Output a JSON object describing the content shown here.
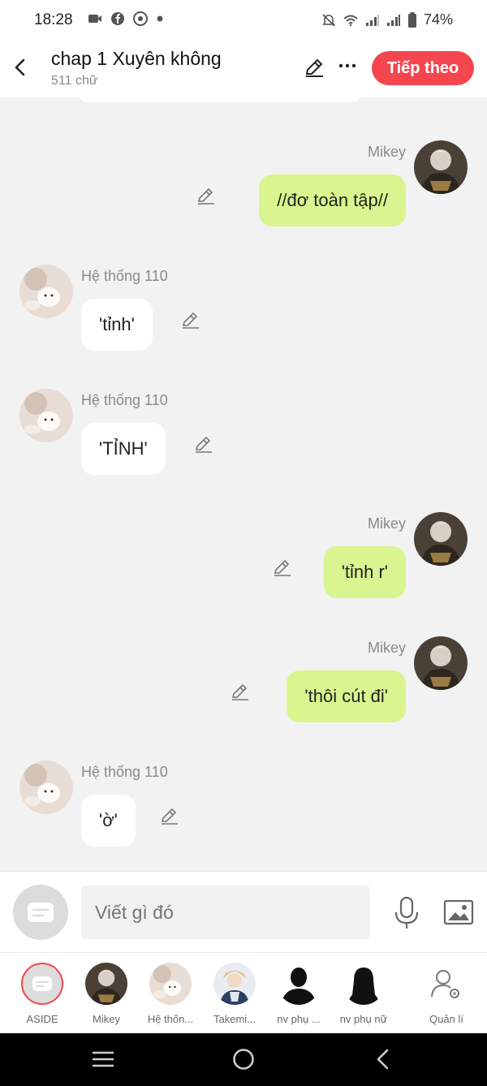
{
  "status_bar": {
    "time": "18:28",
    "battery": "74%",
    "icons": [
      "video-icon",
      "facebook-icon",
      "chrome-icon",
      "dot-icon",
      "mute-icon",
      "wifi-icon",
      "signal-icon",
      "signal-icon",
      "battery-icon"
    ]
  },
  "header": {
    "title": "chap 1 Xuyên không",
    "subtitle": "511 chữ",
    "next_label": "Tiếp theo"
  },
  "messages": [
    {
      "side": "right",
      "sender": "Mikey",
      "text": "//đơ toàn tập//"
    },
    {
      "side": "left",
      "sender": "Hệ thống 110",
      "text": "'tỉnh'"
    },
    {
      "side": "left",
      "sender": "Hệ thống 110",
      "text": "'TỈNH'"
    },
    {
      "side": "right",
      "sender": "Mikey",
      "text": "'tỉnh r'"
    },
    {
      "side": "right",
      "sender": "Mikey",
      "text": "'thôi cút đi'"
    },
    {
      "side": "left",
      "sender": "Hệ thống 110",
      "text": "'ờ'"
    }
  ],
  "input": {
    "placeholder": "Viết gì đó"
  },
  "characters": [
    {
      "label": "ASIDE"
    },
    {
      "label": "Mikey"
    },
    {
      "label": "Hệ thốn..."
    },
    {
      "label": "Takemi..."
    },
    {
      "label": "nv phụ ..."
    },
    {
      "label": "nv phụ nữ"
    },
    {
      "label": "Quản lí"
    }
  ],
  "colors": {
    "accent": "#f4464f",
    "right_bubble": "#d9f58f",
    "left_bubble": "#ffffff",
    "background": "#f2f2f2"
  }
}
